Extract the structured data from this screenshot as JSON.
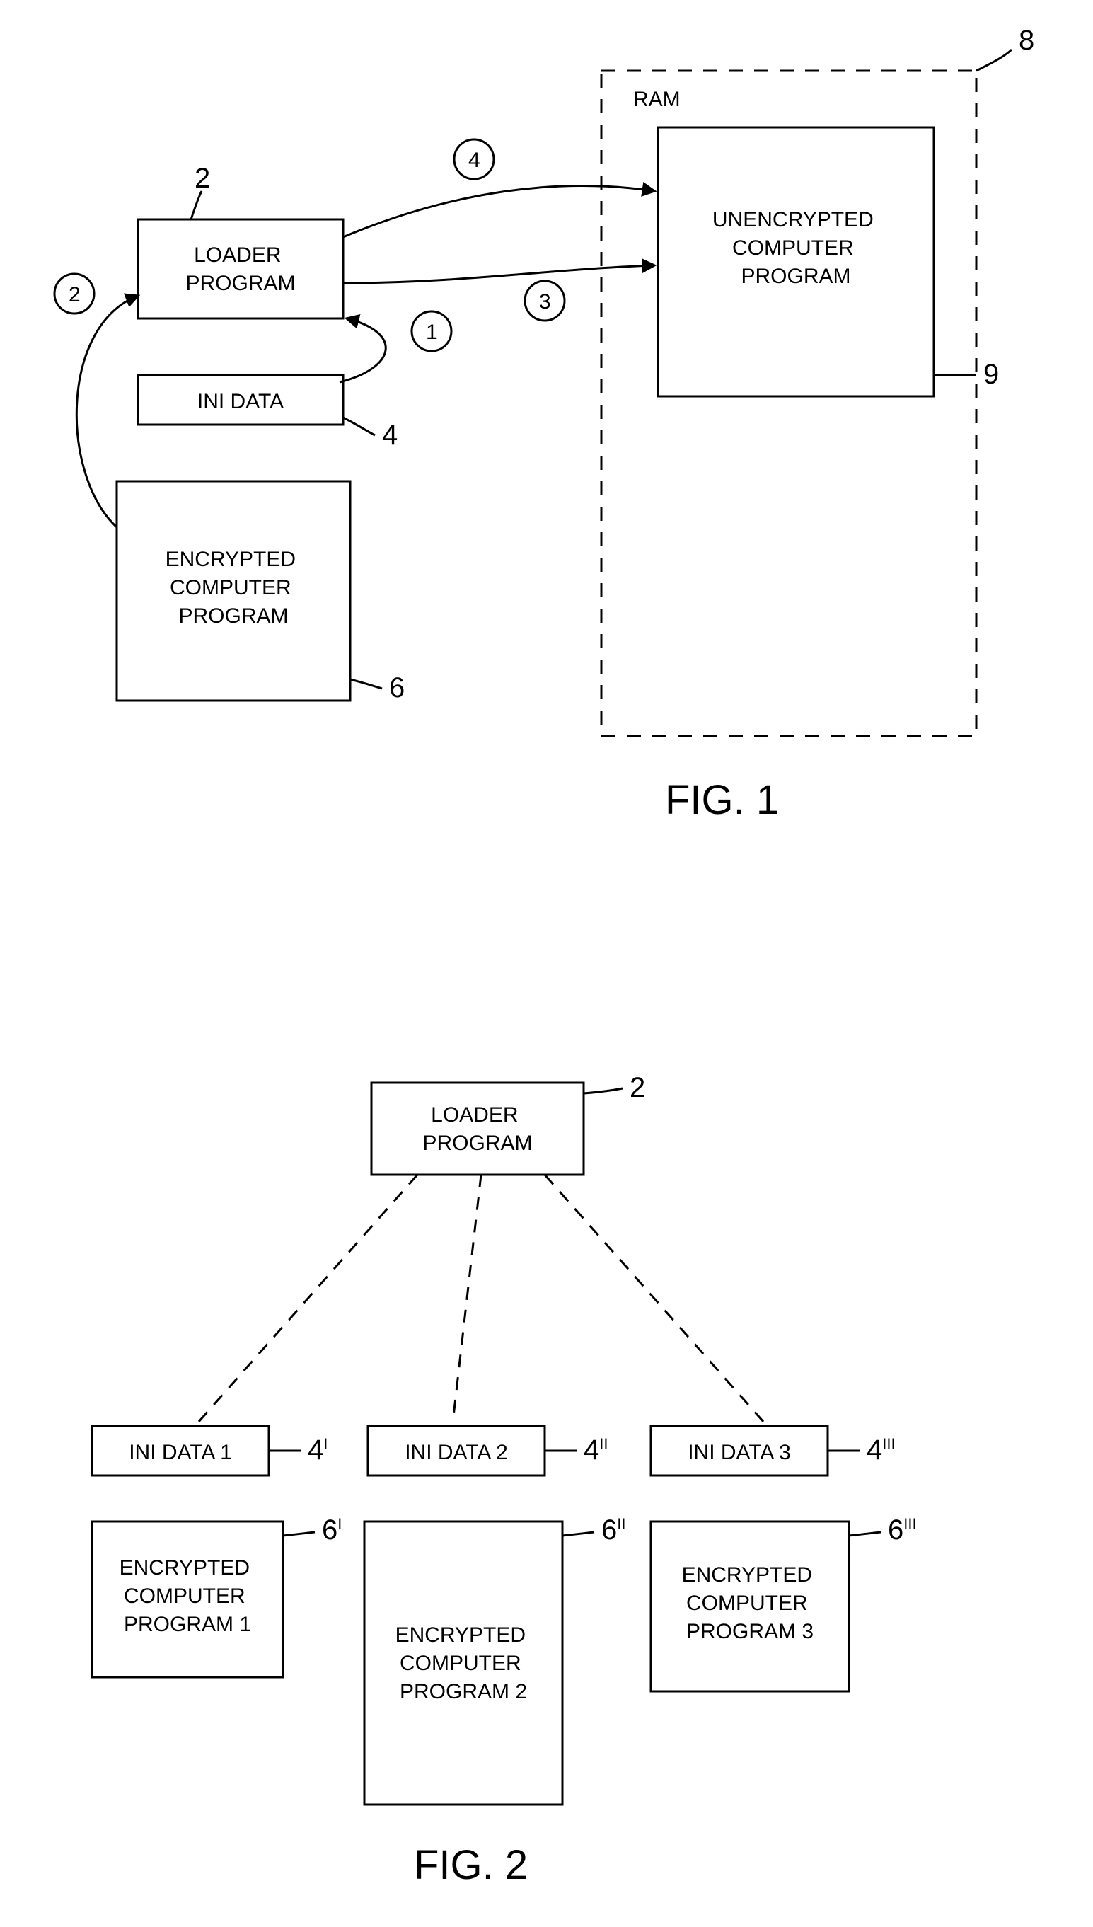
{
  "fig1": {
    "caption": "FIG. 1",
    "boxes": {
      "loader": "LOADER\nPROGRAM",
      "ini": "INI DATA",
      "encrypted": "ENCRYPTED\nCOMPUTER\nPROGRAM",
      "ram": "RAM",
      "unencrypted": "UNENCRYPTED\nCOMPUTER\nPROGRAM"
    },
    "steps": {
      "s1": "1",
      "s2": "2",
      "s3": "3",
      "s4": "4"
    },
    "refs": {
      "loader": "2",
      "ini": "4",
      "encrypted": "6",
      "ram": "8",
      "unencrypted": "9"
    }
  },
  "fig2": {
    "caption": "FIG. 2",
    "boxes": {
      "loader": "LOADER\nPROGRAM",
      "ini1": "INI DATA 1",
      "ini2": "INI DATA 2",
      "ini3": "INI DATA 3",
      "enc1": "ENCRYPTED\nCOMPUTER\nPROGRAM 1",
      "enc2": "ENCRYPTED\nCOMPUTER\nPROGRAM 2",
      "enc3": "ENCRYPTED\nCOMPUTER\nPROGRAM 3"
    },
    "refs": {
      "loader": "2",
      "ini1": "4",
      "ini1s": "I",
      "ini2": "4",
      "ini2s": "II",
      "ini3": "4",
      "ini3s": "III",
      "enc1": "6",
      "enc1s": "I",
      "enc2": "6",
      "enc2s": "II",
      "enc3": "6",
      "enc3s": "III"
    }
  }
}
